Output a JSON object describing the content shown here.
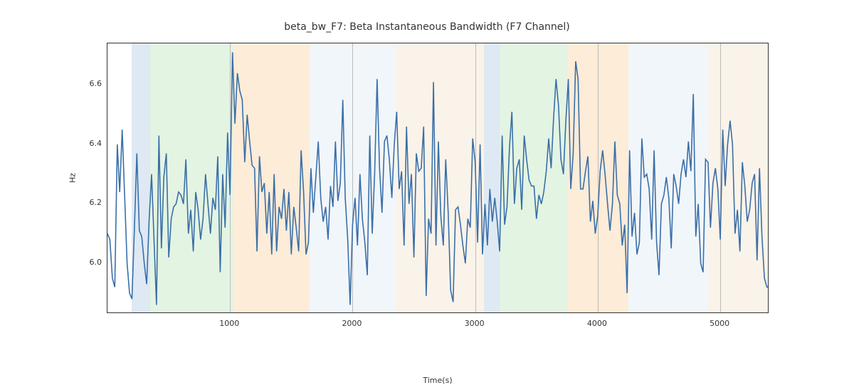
{
  "chart_data": {
    "type": "line",
    "title": "beta_bw_F7: Beta Instantaneous Bandwidth (F7 Channel)",
    "xlabel": "Time(s)",
    "ylabel": "Hz",
    "xlim": [
      0,
      5400
    ],
    "ylim": [
      5.83,
      6.74
    ],
    "xticks": [
      1000,
      2000,
      3000,
      4000,
      5000
    ],
    "yticks": [
      6.0,
      6.2,
      6.4,
      6.6
    ],
    "grid_x": true,
    "bands": [
      {
        "start": 200,
        "end": 350,
        "color": "#a0c0e0"
      },
      {
        "start": 350,
        "end": 1020,
        "color": "#b0e0b0"
      },
      {
        "start": 1020,
        "end": 1650,
        "color": "#f5c890"
      },
      {
        "start": 1650,
        "end": 2350,
        "color": "#d6e4f0"
      },
      {
        "start": 2350,
        "end": 3070,
        "color": "#f2ddc0"
      },
      {
        "start": 3070,
        "end": 3200,
        "color": "#a0c0e0"
      },
      {
        "start": 3200,
        "end": 3750,
        "color": "#b0e0b0"
      },
      {
        "start": 3750,
        "end": 4250,
        "color": "#f5c890"
      },
      {
        "start": 4250,
        "end": 4900,
        "color": "#d6e4f0"
      },
      {
        "start": 4900,
        "end": 5400,
        "color": "#f2ddc0"
      }
    ],
    "series": [
      {
        "name": "beta_bw_F7",
        "color": "#3b6fa8",
        "x": [
          0,
          20,
          40,
          60,
          80,
          100,
          120,
          140,
          160,
          180,
          200,
          220,
          240,
          260,
          280,
          300,
          320,
          340,
          360,
          380,
          400,
          420,
          440,
          460,
          480,
          500,
          520,
          540,
          560,
          580,
          600,
          620,
          640,
          660,
          680,
          700,
          720,
          740,
          760,
          780,
          800,
          820,
          840,
          860,
          880,
          900,
          920,
          940,
          960,
          980,
          1000,
          1020,
          1040,
          1060,
          1080,
          1100,
          1120,
          1140,
          1160,
          1180,
          1200,
          1220,
          1240,
          1260,
          1280,
          1300,
          1320,
          1340,
          1360,
          1380,
          1400,
          1420,
          1440,
          1460,
          1480,
          1500,
          1520,
          1540,
          1560,
          1580,
          1600,
          1620,
          1640,
          1660,
          1680,
          1700,
          1720,
          1740,
          1760,
          1780,
          1800,
          1820,
          1840,
          1860,
          1880,
          1900,
          1920,
          1940,
          1960,
          1980,
          2000,
          2020,
          2040,
          2060,
          2080,
          2100,
          2120,
          2140,
          2160,
          2180,
          2200,
          2220,
          2240,
          2260,
          2280,
          2300,
          2320,
          2340,
          2360,
          2380,
          2400,
          2420,
          2440,
          2460,
          2480,
          2500,
          2520,
          2540,
          2560,
          2580,
          2600,
          2620,
          2640,
          2660,
          2680,
          2700,
          2720,
          2740,
          2760,
          2780,
          2800,
          2820,
          2840,
          2860,
          2880,
          2900,
          2920,
          2940,
          2960,
          2980,
          3000,
          3020,
          3040,
          3060,
          3080,
          3100,
          3120,
          3140,
          3160,
          3180,
          3200,
          3220,
          3240,
          3260,
          3280,
          3300,
          3320,
          3340,
          3360,
          3380,
          3400,
          3420,
          3440,
          3460,
          3480,
          3500,
          3520,
          3540,
          3560,
          3580,
          3600,
          3620,
          3640,
          3660,
          3680,
          3700,
          3720,
          3740,
          3760,
          3780,
          3800,
          3820,
          3840,
          3860,
          3880,
          3900,
          3920,
          3940,
          3960,
          3980,
          4000,
          4020,
          4040,
          4060,
          4080,
          4100,
          4120,
          4140,
          4160,
          4180,
          4200,
          4220,
          4240,
          4260,
          4280,
          4300,
          4320,
          4340,
          4360,
          4380,
          4400,
          4420,
          4440,
          4460,
          4480,
          4500,
          4520,
          4540,
          4560,
          4580,
          4600,
          4620,
          4640,
          4660,
          4680,
          4700,
          4720,
          4740,
          4760,
          4780,
          4800,
          4820,
          4840,
          4860,
          4880,
          4900,
          4920,
          4940,
          4960,
          4980,
          5000,
          5020,
          5040,
          5060,
          5080,
          5100,
          5120,
          5140,
          5160,
          5180,
          5200,
          5220,
          5240,
          5260,
          5280,
          5300,
          5320,
          5340,
          5360,
          5380,
          5400
        ],
        "y": [
          6.1,
          6.08,
          5.95,
          5.92,
          6.4,
          6.24,
          6.45,
          6.23,
          6.0,
          5.9,
          5.88,
          6.12,
          6.37,
          6.11,
          6.09,
          6.0,
          5.93,
          6.15,
          6.3,
          6.08,
          5.86,
          6.43,
          6.05,
          6.29,
          6.37,
          6.02,
          6.15,
          6.19,
          6.2,
          6.24,
          6.23,
          6.2,
          6.35,
          6.1,
          6.18,
          6.04,
          6.24,
          6.18,
          6.08,
          6.15,
          6.3,
          6.2,
          6.1,
          6.22,
          6.18,
          6.36,
          5.97,
          6.3,
          6.12,
          6.44,
          6.23,
          6.71,
          6.47,
          6.64,
          6.58,
          6.55,
          6.34,
          6.5,
          6.41,
          6.33,
          6.32,
          6.04,
          6.36,
          6.24,
          6.27,
          6.1,
          6.24,
          6.03,
          6.3,
          6.04,
          6.19,
          6.15,
          6.25,
          6.11,
          6.24,
          6.03,
          6.19,
          6.12,
          6.04,
          6.38,
          6.24,
          6.03,
          6.07,
          6.32,
          6.17,
          6.29,
          6.41,
          6.22,
          6.14,
          6.19,
          6.08,
          6.26,
          6.19,
          6.41,
          6.21,
          6.27,
          6.55,
          6.22,
          6.08,
          5.86,
          6.13,
          6.22,
          6.06,
          6.3,
          6.15,
          6.07,
          5.96,
          6.43,
          6.1,
          6.3,
          6.62,
          6.32,
          6.17,
          6.41,
          6.43,
          6.35,
          6.22,
          6.4,
          6.51,
          6.25,
          6.31,
          6.06,
          6.46,
          6.2,
          6.3,
          6.02,
          6.37,
          6.31,
          6.32,
          6.46,
          5.89,
          6.15,
          6.1,
          6.61,
          6.06,
          6.41,
          6.16,
          6.06,
          6.35,
          6.17,
          5.91,
          5.87,
          6.18,
          6.19,
          6.13,
          6.06,
          6.0,
          6.15,
          6.12,
          6.42,
          6.34,
          6.07,
          6.4,
          6.03,
          6.2,
          6.06,
          6.25,
          6.14,
          6.22,
          6.14,
          6.04,
          6.43,
          6.13,
          6.19,
          6.39,
          6.51,
          6.2,
          6.32,
          6.35,
          6.18,
          6.43,
          6.35,
          6.28,
          6.26,
          6.26,
          6.15,
          6.23,
          6.2,
          6.24,
          6.31,
          6.42,
          6.32,
          6.49,
          6.62,
          6.53,
          6.35,
          6.3,
          6.48,
          6.62,
          6.25,
          6.37,
          6.68,
          6.62,
          6.25,
          6.25,
          6.31,
          6.36,
          6.14,
          6.21,
          6.1,
          6.16,
          6.31,
          6.38,
          6.3,
          6.2,
          6.11,
          6.2,
          6.41,
          6.23,
          6.2,
          6.06,
          6.13,
          5.9,
          6.38,
          6.09,
          6.17,
          6.03,
          6.07,
          6.42,
          6.29,
          6.3,
          6.25,
          6.08,
          6.38,
          6.07,
          5.96,
          6.2,
          6.23,
          6.29,
          6.22,
          6.05,
          6.3,
          6.26,
          6.2,
          6.3,
          6.35,
          6.29,
          6.41,
          6.31,
          6.57,
          6.09,
          6.2,
          6.0,
          5.97,
          6.35,
          6.34,
          6.12,
          6.27,
          6.32,
          6.25,
          6.08,
          6.45,
          6.26,
          6.4,
          6.48,
          6.4,
          6.1,
          6.18,
          6.04,
          6.34,
          6.26,
          6.14,
          6.18,
          6.27,
          6.3,
          6.01,
          6.32,
          6.09,
          5.95,
          5.92,
          5.92
        ]
      }
    ]
  }
}
